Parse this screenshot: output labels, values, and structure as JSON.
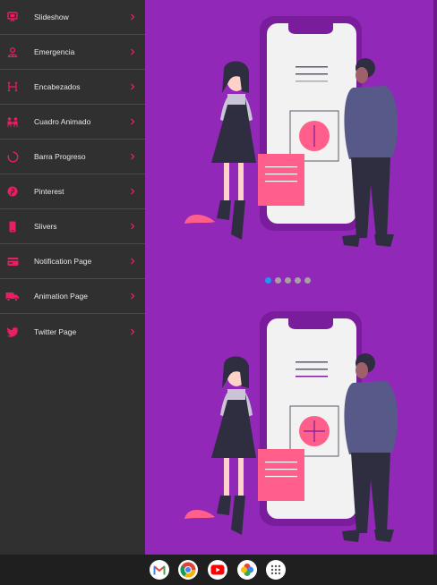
{
  "drawer": {
    "items": [
      {
        "label": "Slideshow",
        "icon": "slideshow-icon"
      },
      {
        "label": "Emergencia",
        "icon": "emergency-icon"
      },
      {
        "label": "Encabezados",
        "icon": "heading-icon"
      },
      {
        "label": "Cuadro Animado",
        "icon": "people-icon"
      },
      {
        "label": "Barra Progreso",
        "icon": "circle-progress-icon"
      },
      {
        "label": "Pinterest",
        "icon": "pinterest-icon"
      },
      {
        "label": "Slivers",
        "icon": "phone-icon"
      },
      {
        "label": "Notification Page",
        "icon": "card-icon"
      },
      {
        "label": "Animation Page",
        "icon": "truck-icon"
      },
      {
        "label": "Twitter Page",
        "icon": "twitter-icon"
      }
    ]
  },
  "slideshow": {
    "dot_count": 5,
    "active_index": 0
  },
  "taskbar": {
    "apps": [
      "gmail-icon",
      "chrome-icon",
      "youtube-icon",
      "photos-icon",
      "launcher-icon"
    ]
  },
  "colors": {
    "accent": "#e91e63",
    "background": "#9128b8",
    "drawer": "#303030",
    "dot_active": "#2196f3"
  }
}
